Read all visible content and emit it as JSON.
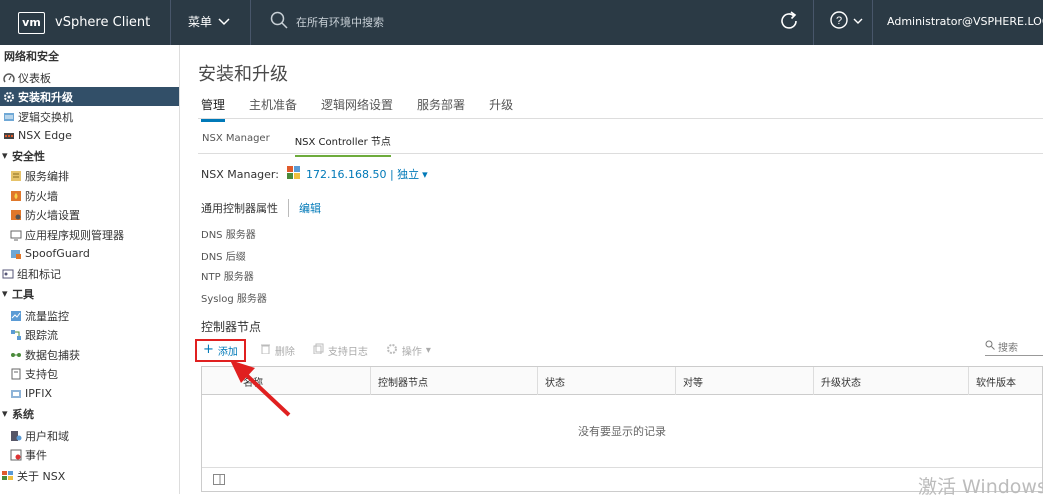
{
  "header": {
    "logo": "vm",
    "app_name": "vSphere Client",
    "menu_label": "菜单",
    "search_placeholder": "在所有环境中搜索",
    "user": "Administrator@VSPHERE.LOCA"
  },
  "sidebar": {
    "items": [
      {
        "label": "网络和安全",
        "type": "section"
      },
      {
        "label": "仪表板",
        "icon": "dashboard-icon"
      },
      {
        "label": "安装和升级",
        "icon": "gear-icon",
        "active": true
      },
      {
        "label": "逻辑交换机",
        "icon": "logical-switch-icon"
      },
      {
        "label": "NSX Edge",
        "icon": "edge-icon"
      },
      {
        "label": "安全性",
        "type": "group"
      },
      {
        "label": "服务编排",
        "icon": "service-composer-icon"
      },
      {
        "label": "防火墙",
        "icon": "firewall-icon"
      },
      {
        "label": "防火墙设置",
        "icon": "firewall-settings-icon"
      },
      {
        "label": "应用程序规则管理器",
        "icon": "app-rule-icon"
      },
      {
        "label": "SpoofGuard",
        "icon": "spoofguard-icon"
      },
      {
        "label": "组和标记",
        "icon": "groups-icon"
      },
      {
        "label": "工具",
        "type": "group"
      },
      {
        "label": "流量监控",
        "icon": "flow-monitor-icon"
      },
      {
        "label": "跟踪流",
        "icon": "traceflow-icon"
      },
      {
        "label": "数据包捕获",
        "icon": "packet-capture-icon"
      },
      {
        "label": "支持包",
        "icon": "support-bundle-icon"
      },
      {
        "label": "IPFIX",
        "icon": "ipfix-icon"
      },
      {
        "label": "系统",
        "type": "group"
      },
      {
        "label": "用户和域",
        "icon": "users-icon"
      },
      {
        "label": "事件",
        "icon": "events-icon"
      },
      {
        "label": "关于 NSX",
        "icon": "about-icon"
      }
    ]
  },
  "main": {
    "title": "安装和升级",
    "tabs": [
      "管理",
      "主机准备",
      "逻辑网络设置",
      "服务部署",
      "升级"
    ],
    "active_tab": "管理",
    "subtabs": [
      "NSX Manager",
      "NSX Controller 节点"
    ],
    "active_subtab": "NSX Controller 节点",
    "nsx_manager_label": "NSX Manager:",
    "nsx_manager_value": "172.16.168.50 | 独立",
    "controller_props_label": "通用控制器属性",
    "edit_label": "编辑",
    "props": [
      "DNS 服务器",
      "DNS 后缀",
      "NTP 服务器",
      "Syslog 服务器"
    ],
    "nodes_title": "控制器节点",
    "toolbar": {
      "add": "添加",
      "delete": "删除",
      "support_log": "支持日志",
      "actions": "操作"
    },
    "grid_search_placeholder": "搜索",
    "grid": {
      "columns": [
        "名称",
        "控制器节点",
        "状态",
        "对等",
        "升级状态",
        "软件版本"
      ],
      "empty_text": "没有要显示的记录"
    }
  },
  "watermark": "激活 Windows",
  "colors": {
    "topbar": "#2b3a45",
    "active_nav": "#324f68",
    "link": "#0079b8",
    "highlight_box": "#e02020"
  }
}
